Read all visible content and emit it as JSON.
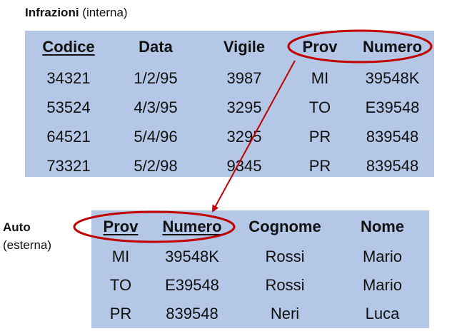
{
  "infrazioni": {
    "title_bold": "Infrazioni",
    "title_rest": " (interna)",
    "columns": [
      "Codice",
      "Data",
      "Vigile",
      "Prov",
      "Numero"
    ],
    "rows": [
      [
        "34321",
        "1/2/95",
        "3987",
        "MI",
        "39548K"
      ],
      [
        "53524",
        "4/3/95",
        "3295",
        "TO",
        "E39548"
      ],
      [
        "64521",
        "5/4/96",
        "3295",
        "PR",
        "839548"
      ],
      [
        "73321",
        "5/2/98",
        "9345",
        "PR",
        "839548"
      ]
    ]
  },
  "auto": {
    "title_bold": "Auto",
    "title_rest": "(esterna)",
    "columns": [
      "Prov",
      "Numero",
      "Cognome",
      "Nome"
    ],
    "rows": [
      [
        "MI",
        "39548K",
        "Rossi",
        "Mario"
      ],
      [
        "TO",
        "E39548",
        "Rossi",
        "Mario"
      ],
      [
        "PR",
        "839548",
        "Neri",
        "Luca"
      ]
    ]
  },
  "colors": {
    "table_bg": "#b4c7e7",
    "highlight": "#c00000"
  }
}
